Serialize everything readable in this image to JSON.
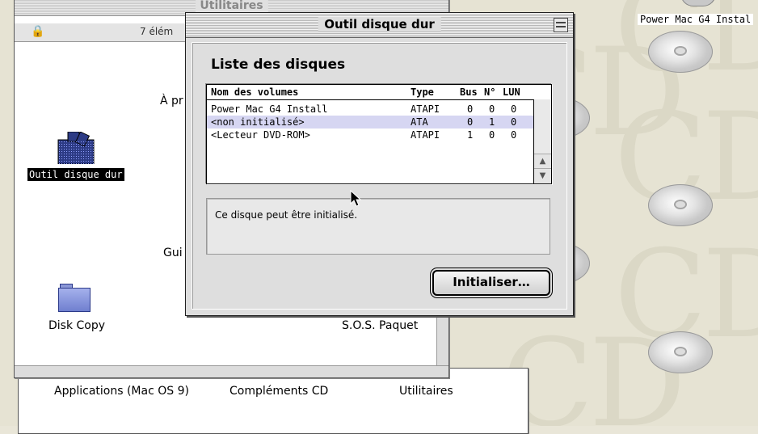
{
  "desktop": {
    "background_letters": "CD",
    "disk_label": "Power Mac G4 Instal"
  },
  "back_window": {
    "title": "Utilitaires",
    "item_count": "7 élém",
    "partial_item_1": "À pr",
    "partial_item_2": "Gui",
    "selected_icon_label": "Outil disque dur",
    "disk_copy_label": "Disk Copy",
    "sos_label": "S.O.S. Paquet"
  },
  "bottom_window": {
    "items": [
      "Applications (Mac OS 9)",
      "Compléments CD",
      "Utilitaires"
    ]
  },
  "dialog": {
    "title": "Outil disque dur",
    "heading": "Liste des disques",
    "columns": [
      "Nom des volumes",
      "Type",
      "Bus",
      "N°",
      "LUN"
    ],
    "rows": [
      {
        "name": "Power Mac G4 Install",
        "type": "ATAPI",
        "bus": "0",
        "no": "0",
        "lun": "0"
      },
      {
        "name": "<non initialisé>",
        "type": "ATA",
        "bus": "0",
        "no": "1",
        "lun": "0"
      },
      {
        "name": "<Lecteur DVD-ROM>",
        "type": "ATAPI",
        "bus": "1",
        "no": "0",
        "lun": "0"
      }
    ],
    "selected_row": 1,
    "info_text": "Ce disque peut être initialisé.",
    "button_label": "Initialiser…"
  },
  "colors": {
    "selection": "#d6d6f2",
    "dialog_bg": "#dedede",
    "desktop_bg": "#e6e3d3"
  }
}
